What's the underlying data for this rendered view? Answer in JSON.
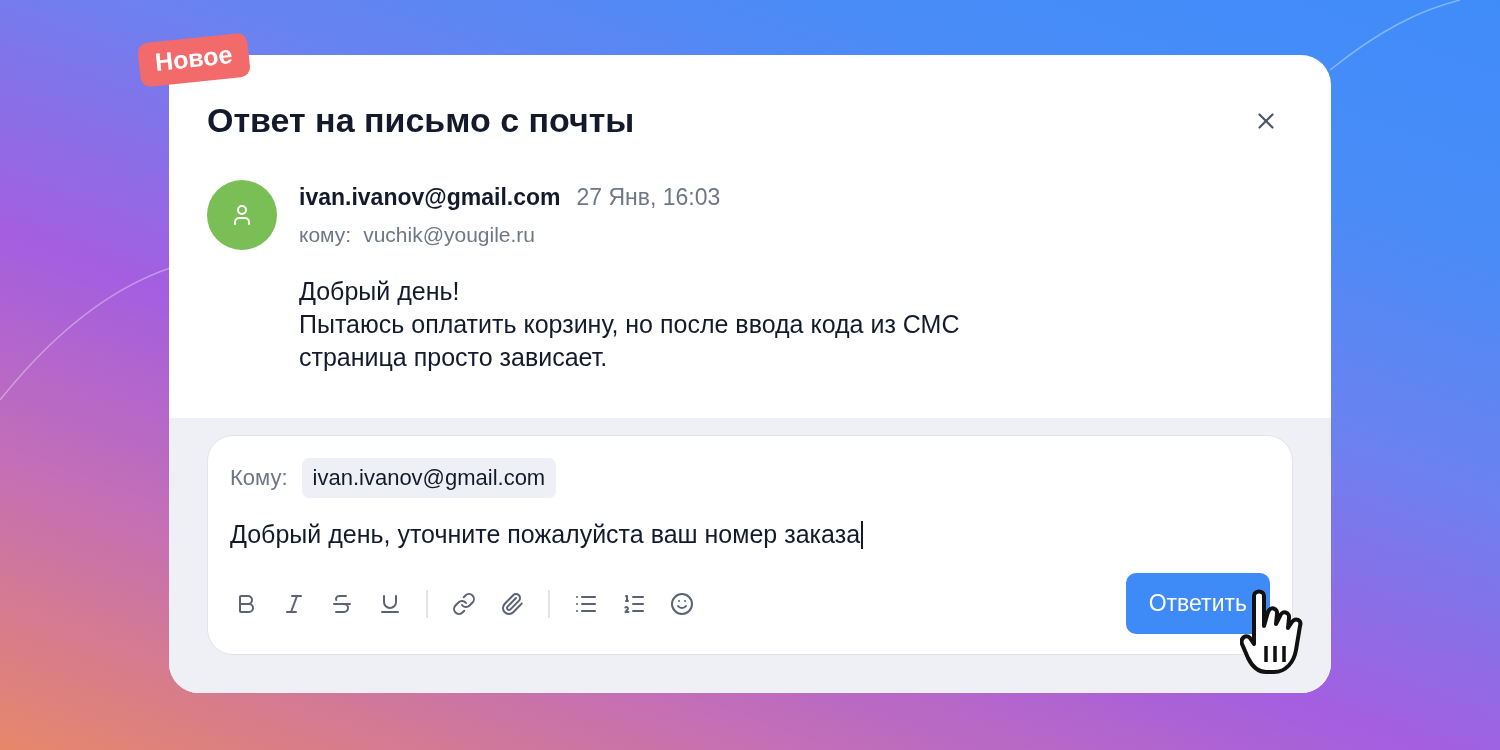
{
  "badge": "Новое",
  "dialog": {
    "title": "Ответ на письмо с почты"
  },
  "message": {
    "sender": "ivan.ivanov@gmail.com",
    "date": "27 Янв, 16:03",
    "to_label": "кому:",
    "to": "vuchik@yougile.ru",
    "body": [
      "Добрый день!",
      "Пытаюсь оплатить корзину, но после ввода кода из СМС",
      "страница просто зависает."
    ]
  },
  "reply": {
    "to_label": "Кому:",
    "recipient": "ivan.ivanov@gmail.com",
    "value": "Добрый день, уточните пожалуйста ваш номер заказа",
    "send_button": "Ответить"
  }
}
